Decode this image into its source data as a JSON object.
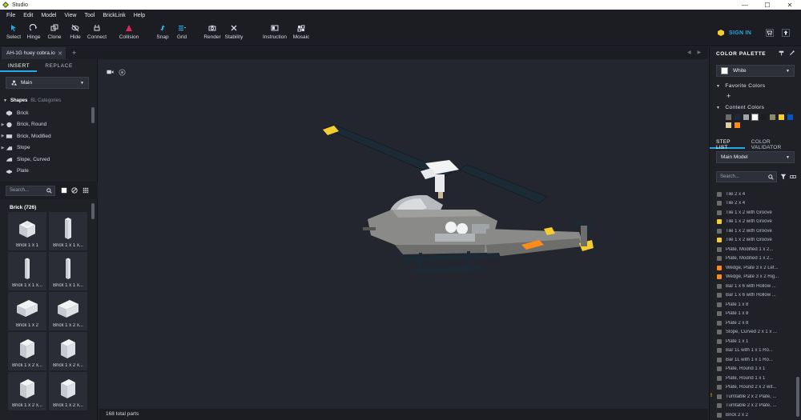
{
  "window": {
    "title": "Studio",
    "controls": [
      "—",
      "☐",
      "✕"
    ]
  },
  "menu": [
    "File",
    "Edit",
    "Model",
    "View",
    "Tool",
    "BrickLink",
    "Help"
  ],
  "toolbar": {
    "tools": [
      {
        "name": "select",
        "label": "Select"
      },
      {
        "name": "hinge",
        "label": "Hinge"
      },
      {
        "name": "clone",
        "label": "Clone"
      },
      {
        "name": "hide",
        "label": "Hide"
      },
      {
        "name": "connect",
        "label": "Connect"
      },
      {
        "name": "collision",
        "label": "Collision"
      },
      {
        "name": "snap",
        "label": "Snap"
      },
      {
        "name": "grid",
        "label": "Grid"
      },
      {
        "name": "render",
        "label": "Render"
      },
      {
        "name": "stability",
        "label": "Stability"
      },
      {
        "name": "instruction",
        "label": "Instruction"
      },
      {
        "name": "mosaic",
        "label": "Mosaic"
      }
    ],
    "sign_in": "SIGN IN"
  },
  "tab": {
    "label": "AH-1G huey cobra.io",
    "close": "✕",
    "add": "+"
  },
  "left_panel": {
    "tabs": [
      "INSERT",
      "REPLACE"
    ],
    "palette_select": "Main",
    "shape_tabs": [
      "Shapes",
      "BL Categories"
    ],
    "shapes": [
      "Brick",
      "Brick, Round",
      "Brick, Modified",
      "Slope",
      "Slope, Curved",
      "Plate"
    ],
    "search_placeholder": "Search...",
    "category_header": "Brick (726)",
    "bricks": [
      "Brick 1 x 1",
      "Brick 1 x 1 x...",
      "Brick 1 x 1 x...",
      "Brick 1 x 1 x...",
      "Brick 1 x 2",
      "Brick 1 x 2 x...",
      "Brick 1 x 2 x...",
      "Brick 1 x 2 x...",
      "Brick 1 x 2 x...",
      "Brick 1 x 2 x..."
    ]
  },
  "viewport": {
    "status": "168 total parts"
  },
  "right_panel": {
    "color_palette_title": "COLOR PALETTE",
    "selected_color": "White",
    "favorite_colors_label": "Favorite Colors",
    "content_colors_label": "Content Colors",
    "content_colors": [
      "#6d6e6c",
      "#1b2a34",
      "#a0a5a9",
      "#ffffff",
      "#1b1d22",
      "#8c8a6a",
      "#f5cd2f",
      "#0055bf",
      "#e4cd9e",
      "#fe8a18"
    ],
    "tabs": [
      "STEP LIST",
      "COLOR VALIDATOR"
    ],
    "model_select": "Main Model",
    "search_placeholder": "Search...",
    "steps": [
      {
        "label": "Tile 2 x 4",
        "color": "#6d6e6c"
      },
      {
        "label": "Tile 2 x 4",
        "color": "#6d6e6c"
      },
      {
        "label": "Tile 1 x 2 with Groove",
        "color": "#6d6e6c"
      },
      {
        "label": "Tile 1 x 2 with Groove",
        "color": "#f5cd2f"
      },
      {
        "label": "Tile 1 x 2 with Groove",
        "color": "#6d6e6c"
      },
      {
        "label": "Tile 1 x 2 with Groove",
        "color": "#f5cd2f"
      },
      {
        "label": "Plate, Modified 1 x 2...",
        "color": "#6d6e6c"
      },
      {
        "label": "Plate, Modified 1 x 2...",
        "color": "#6d6e6c"
      },
      {
        "label": "Wedge, Plate 3 x 2 Lef...",
        "color": "#fe8a18"
      },
      {
        "label": "Wedge, Plate 3 x 2 Rig...",
        "color": "#fe8a18"
      },
      {
        "label": "Bar 1 x 6 with Hollow ...",
        "color": "#6d6e6c"
      },
      {
        "label": "Bar 1 x 6 with Hollow ...",
        "color": "#6d6e6c"
      },
      {
        "label": "Plate 1 x 8",
        "color": "#6d6e6c"
      },
      {
        "label": "Plate 1 x 8",
        "color": "#6d6e6c"
      },
      {
        "label": "Plate 2 x 8",
        "color": "#6d6e6c"
      },
      {
        "label": "Slope, Curved 2 x 1 x ...",
        "color": "#6d6e6c"
      },
      {
        "label": "Plate 1 x 1",
        "color": "#6d6e6c"
      },
      {
        "label": "Bar   1L with 1 x 1 Ro...",
        "color": "#6d6e6c"
      },
      {
        "label": "Bar   1L with 1 x 1 Ro...",
        "color": "#6d6e6c"
      },
      {
        "label": "Plate, Round 1 x 1",
        "color": "#6d6e6c"
      },
      {
        "label": "Plate, Round 1 x 1",
        "color": "#6d6e6c"
      },
      {
        "label": "Plate, Round 2 x 2 wit...",
        "color": "#6d6e6c"
      },
      {
        "label": "Turntable 2 x 2 Plate, ...",
        "color": "#6d6e6c"
      },
      {
        "label": "Turntable 2 x 2 Plate, ...",
        "color": "#6d6e6c"
      },
      {
        "label": "Brick 2 x 2",
        "color": "#6d6e6c"
      }
    ],
    "warning_mark": "!"
  }
}
